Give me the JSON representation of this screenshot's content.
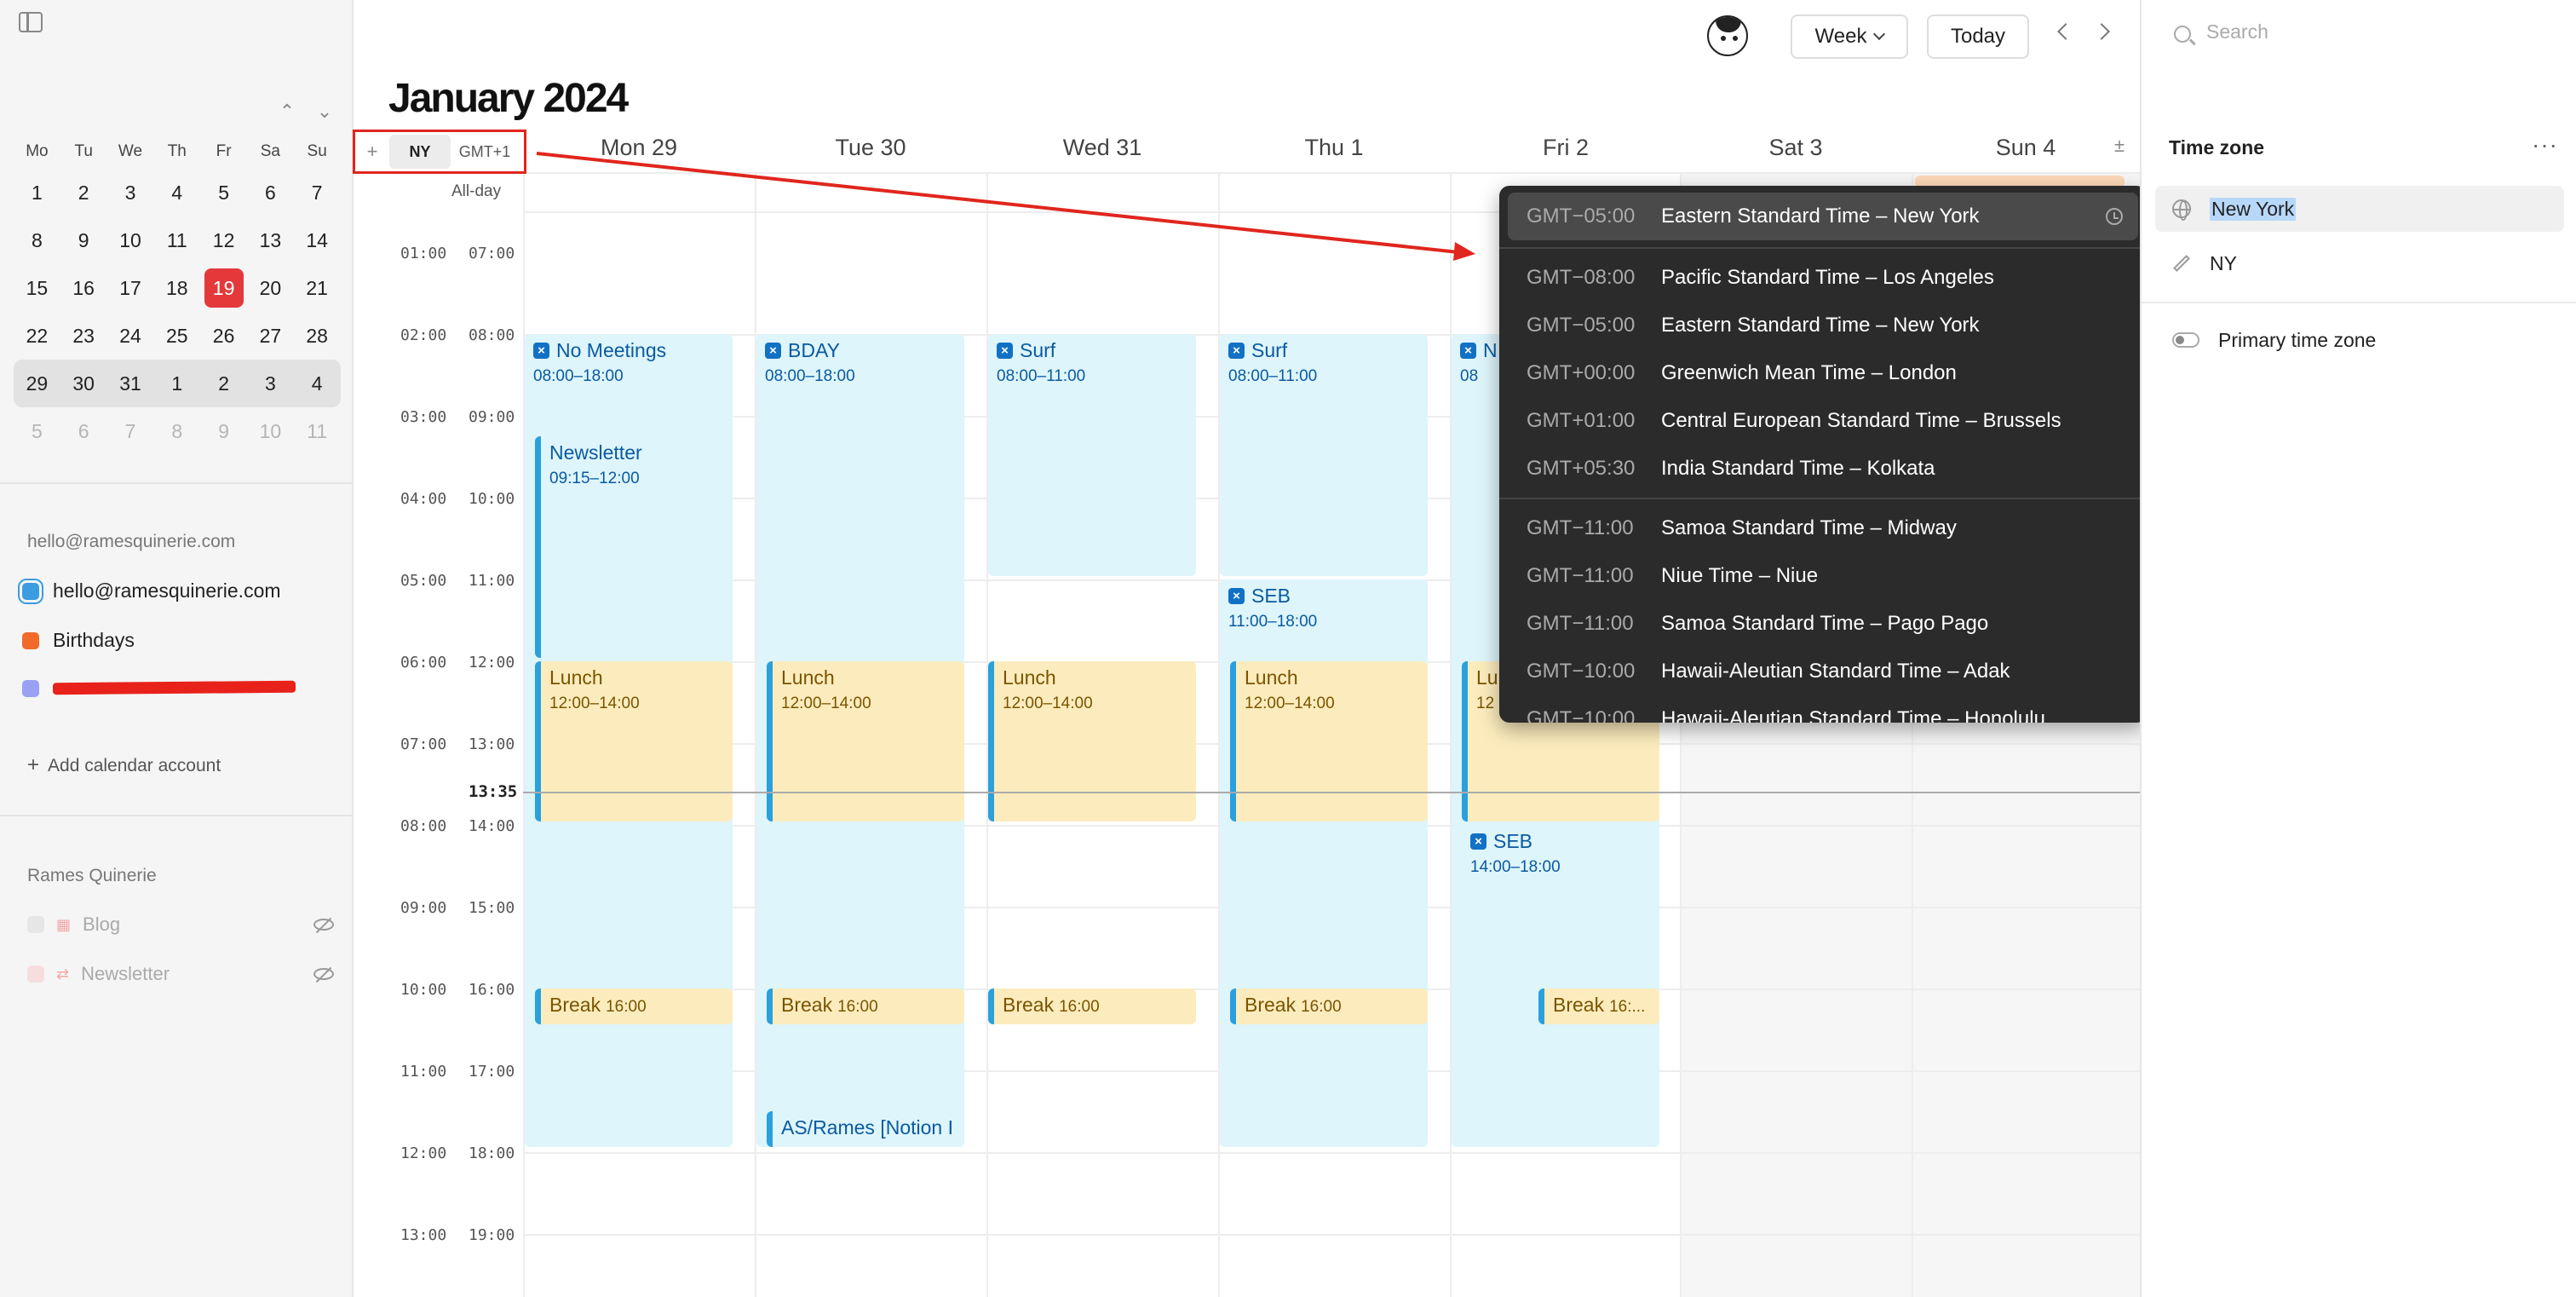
{
  "title": {
    "month": "January",
    "year": " 2024"
  },
  "header": {
    "view_label": "Week",
    "today_label": "Today"
  },
  "mini_calendar": {
    "weekdays": [
      "Mo",
      "Tu",
      "We",
      "Th",
      "Fr",
      "Sa",
      "Su"
    ],
    "weeks": [
      [
        "1",
        "2",
        "3",
        "4",
        "5",
        "6",
        "7"
      ],
      [
        "8",
        "9",
        "10",
        "11",
        "12",
        "13",
        "14"
      ],
      [
        "15",
        "16",
        "17",
        "18",
        "19",
        "20",
        "21"
      ],
      [
        "22",
        "23",
        "24",
        "25",
        "26",
        "27",
        "28"
      ],
      [
        "29",
        "30",
        "31",
        "1",
        "2",
        "3",
        "4"
      ],
      [
        "5",
        "6",
        "7",
        "8",
        "9",
        "10",
        "11"
      ]
    ]
  },
  "sidebar": {
    "account_email": "hello@ramesquinerie.com",
    "calendars": [
      "hello@ramesquinerie.com",
      "Birthdays"
    ],
    "add_calendar": "Add calendar account",
    "workspace": "Rames Quinerie",
    "workspace_items": [
      "Blog",
      "Newsletter"
    ]
  },
  "timezones": {
    "primary": "NY",
    "secondary": "GMT+1",
    "allday": "All-day",
    "now": "13:35"
  },
  "days": [
    "Mon 29",
    "Tue 30",
    "Wed 31",
    "Thu 1",
    "Fri 2",
    "Sat 3",
    "Sun 4"
  ],
  "hours": {
    "left": [
      "01:00",
      "02:00",
      "03:00",
      "04:00",
      "05:00",
      "06:00",
      "07:00",
      "08:00",
      "09:00",
      "10:00",
      "11:00",
      "12:00",
      "13:00"
    ],
    "right": [
      "07:00",
      "08:00",
      "09:00",
      "10:00",
      "11:00",
      "12:00",
      "13:00",
      "14:00",
      "15:00",
      "16:00",
      "17:00",
      "18:00",
      "19:00"
    ]
  },
  "events": {
    "no_meetings": {
      "title": "No Meetings",
      "time": "08:00–18:00"
    },
    "newsletter": {
      "title": "Newsletter",
      "time": "09:15–12:00"
    },
    "bday": {
      "title": "BDAY",
      "time": "08:00–18:00"
    },
    "surf_wed": {
      "title": "Surf",
      "time": "08:00–11:00"
    },
    "surf_thu": {
      "title": "Surf",
      "time": "08:00–11:00"
    },
    "fri_top": {
      "title": "N",
      "time": "08"
    },
    "seb_thu": {
      "title": "SEB",
      "time": "11:00–18:00"
    },
    "seb_fri": {
      "title": "SEB",
      "time": "14:00–18:00"
    },
    "lunch": {
      "title": "Lunch",
      "time": "12:00–14:00"
    },
    "lunch_fri": {
      "title": "Lu",
      "time": "12"
    },
    "break": {
      "title": "Break",
      "time": "16:00"
    },
    "break_fri": {
      "title": "Break",
      "time": "16:..."
    },
    "notion": {
      "title": "AS/Rames [Notion I"
    }
  },
  "tz_dropdown": {
    "selected": {
      "offset": "GMT−05:00",
      "name": "Eastern Standard Time  –  New York"
    },
    "group1": [
      {
        "offset": "GMT−08:00",
        "name": "Pacific Standard Time  –  Los Angeles"
      },
      {
        "offset": "GMT−05:00",
        "name": "Eastern Standard Time  –  New York"
      },
      {
        "offset": "GMT+00:00",
        "name": "Greenwich Mean Time  –  London"
      },
      {
        "offset": "GMT+01:00",
        "name": "Central European Standard Time  –  Brussels"
      },
      {
        "offset": "GMT+05:30",
        "name": "India Standard Time  –  Kolkata"
      }
    ],
    "group2": [
      {
        "offset": "GMT−11:00",
        "name": "Samoa Standard Time  –  Midway"
      },
      {
        "offset": "GMT−11:00",
        "name": "Niue Time  –  Niue"
      },
      {
        "offset": "GMT−11:00",
        "name": "Samoa Standard Time  –  Pago Pago"
      },
      {
        "offset": "GMT−10:00",
        "name": "Hawaii-Aleutian Standard Time  –  Adak"
      },
      {
        "offset": "GMT−10:00",
        "name": "Hawaii-Aleutian Standard Time  –  Honolulu"
      }
    ]
  },
  "right_panel": {
    "search_placeholder": "Search",
    "section_title": "Time zone",
    "tz_value": "New York",
    "tz_label": "NY",
    "primary_toggle": "Primary time zone"
  },
  "colors": {
    "accent_red": "#e5383b",
    "event_blue": "#ddf5fb",
    "event_yellow": "#fcecbd",
    "annotation_red": "#e0261d"
  }
}
